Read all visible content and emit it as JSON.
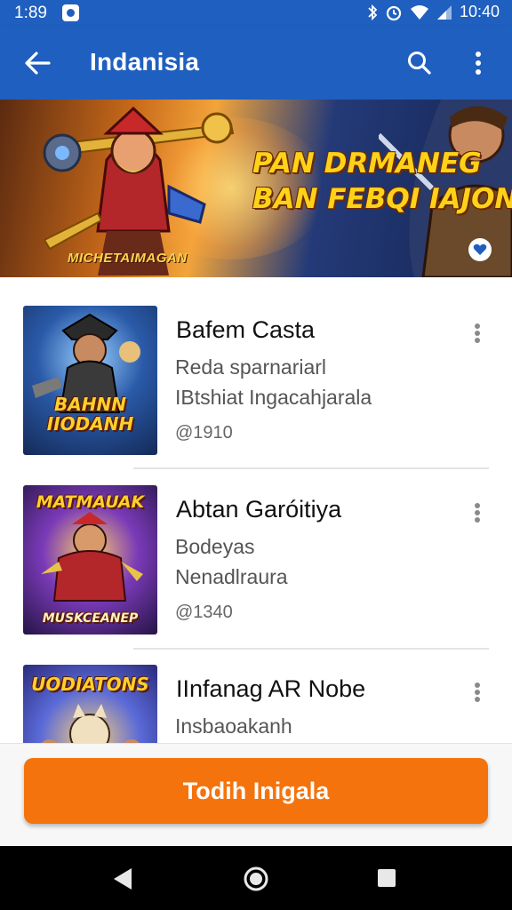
{
  "status_bar": {
    "time_left": "1:89",
    "time_right": "10:40"
  },
  "app_bar": {
    "title": "Indanisia"
  },
  "banner": {
    "headline_line1": "PAN DRMANEG",
    "headline_line2": "BAN FEBQI IAJON",
    "caption": "MICHETAIMAGAN"
  },
  "items": [
    {
      "thumb_title": "BAHNN\nIIODANH",
      "name": "Bafem Casta",
      "sub1": "Reda sparnariarl",
      "sub2": "IBtshiat Ingacahjarala",
      "meta": "@1910"
    },
    {
      "thumb_title": "MATMAUAK",
      "thumb_footer": "MUSKCEANEP",
      "name": "Abtan Garóitiya",
      "sub1": "Bodeyas",
      "sub2": "Nenadlraura",
      "meta": "@1340"
    },
    {
      "thumb_title": "UODIATONS",
      "name": "IInfanag AR Nobe",
      "sub1": "Insbaoakanh",
      "sub2": "",
      "meta": ""
    }
  ],
  "cta": {
    "label": "Todih Inigala"
  },
  "colors": {
    "primary": "#1f5fbf",
    "accent": "#f5730c"
  }
}
